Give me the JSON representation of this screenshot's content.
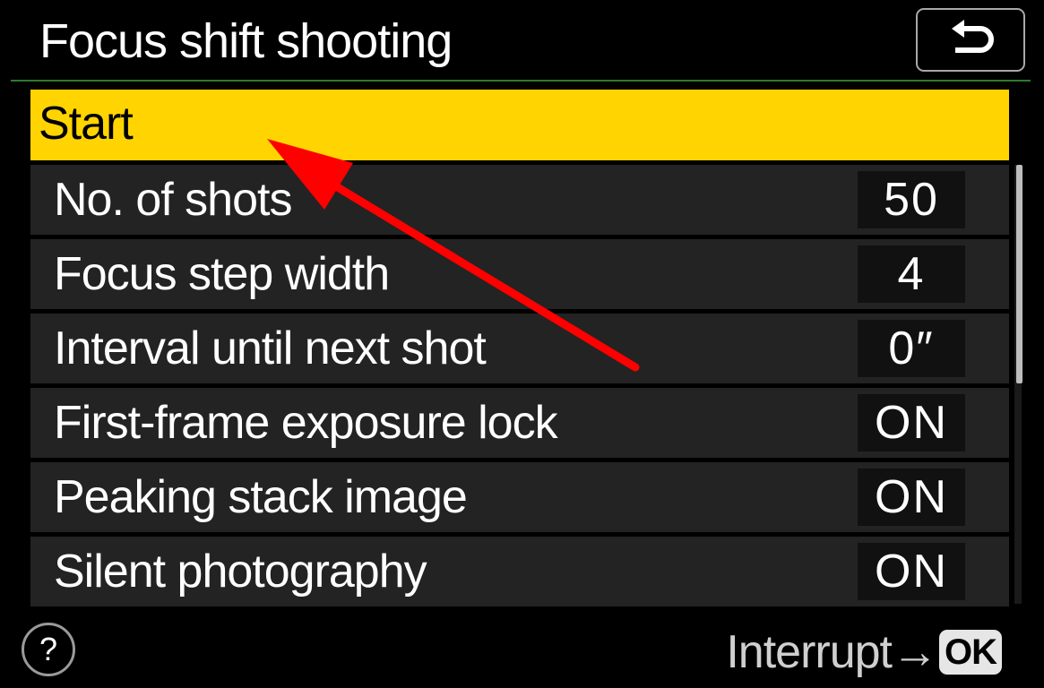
{
  "header": {
    "title": "Focus shift shooting",
    "back_icon": "return-arrow-icon"
  },
  "menu": {
    "items": [
      {
        "label": "Start",
        "value": "",
        "selected": true
      },
      {
        "label": "No. of shots",
        "value": "50"
      },
      {
        "label": "Focus step width",
        "value": "4"
      },
      {
        "label": "Interval until next shot",
        "value": "0″"
      },
      {
        "label": "First-frame exposure lock",
        "value": "ON"
      },
      {
        "label": "Peaking stack image",
        "value": "ON"
      },
      {
        "label": "Silent photography",
        "value": "ON"
      }
    ]
  },
  "footer": {
    "help_symbol": "?",
    "hint_text": "Interrupt→",
    "ok_label": "OK"
  },
  "colors": {
    "highlight": "#ffd400",
    "row_background": "#232323",
    "value_box": "#111111",
    "annotation_arrow": "#ff0000",
    "title_rule": "#2f7a2c"
  }
}
